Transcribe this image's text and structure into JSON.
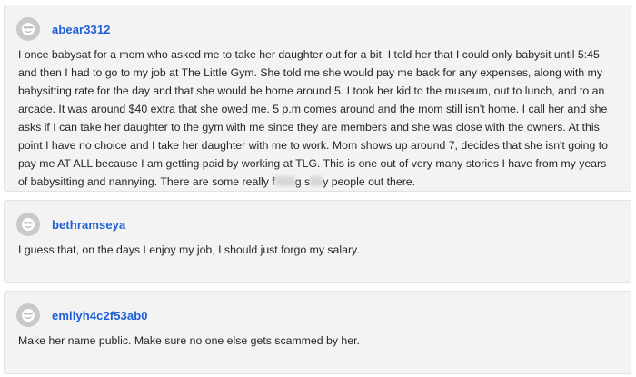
{
  "comments": [
    {
      "username": "abear3312",
      "text_before": "I once babysat for a mom who asked me to take her daughter out for a bit. I told her that I could only babysit until 5:45 and then I had to go to my job at The Little Gym. She told me she would pay me back for any expenses, along with my babysitting rate for the day and that she would be home around 5. I took her kid to the museum, out to lunch, and to an arcade. It was around $40 extra that she owed me. 5 p.m comes around and the mom still isn't home. I call her and she asks if I can take her daughter to the gym with me since they are members and she was close with the owners. At this point I have no choice and I take her daughter with me to work. Mom shows up around 7, decides that she isn't going to pay me AT ALL because I am getting paid by working at TLG. This is one out of very many stories I have from my years of babysitting and nannying. There are some really f",
      "censor_mid": "g s",
      "text_after": "y people out there."
    },
    {
      "username": "bethramseya",
      "text": "I guess that, on the days I enjoy my job, I should just forgo my salary."
    },
    {
      "username": "emilyh4c2f53ab0",
      "text": "Make her name public. Make sure no one else gets scammed by her."
    }
  ],
  "colors": {
    "username": "#1f5fd6",
    "card_background": "#f3f3f3",
    "avatar_background": "#c9c9c9"
  },
  "icons": {
    "avatar": "face-avatar-icon"
  }
}
